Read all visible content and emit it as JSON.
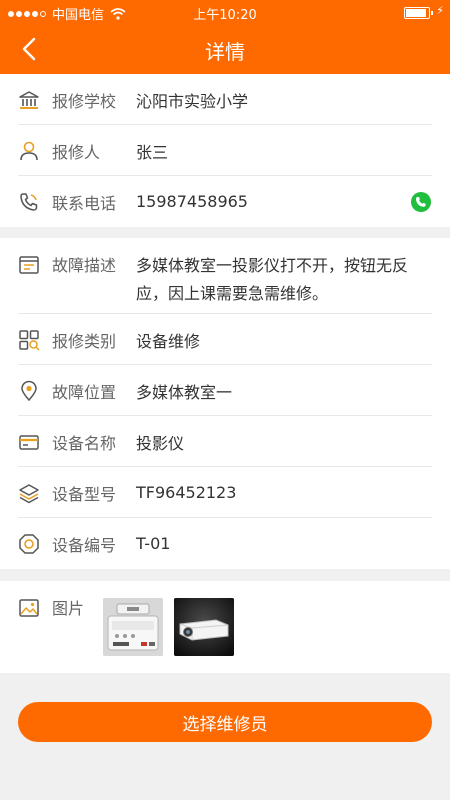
{
  "status_bar": {
    "carrier": "中国电信",
    "time": "上午10:20"
  },
  "header": {
    "title": "详情"
  },
  "reporter_section": {
    "school": {
      "label": "报修学校",
      "value": "沁阳市实验小学"
    },
    "person": {
      "label": "报修人",
      "value": "张三"
    },
    "phone": {
      "label": "联系电话",
      "value": "15987458965"
    }
  },
  "fault_section": {
    "description": {
      "label": "故障描述",
      "value": "多媒体教室一投影仪打不开，按钮无反应，因上课需要急需维修。"
    },
    "type": {
      "label": "报修类别",
      "value": "设备维修"
    },
    "location": {
      "label": "故障位置",
      "value": "多媒体教室一"
    },
    "device_name": {
      "label": "设备名称",
      "value": "投影仪"
    },
    "device_model": {
      "label": "设备型号",
      "value": "TF96452123"
    },
    "device_number": {
      "label": "设备编号",
      "value": "T-01"
    }
  },
  "photos_section": {
    "label": "图片"
  },
  "action": {
    "label": "选择维修员"
  },
  "colors": {
    "accent": "#ff6a00",
    "call": "#1fbe3c",
    "icon": "#e8a020"
  }
}
